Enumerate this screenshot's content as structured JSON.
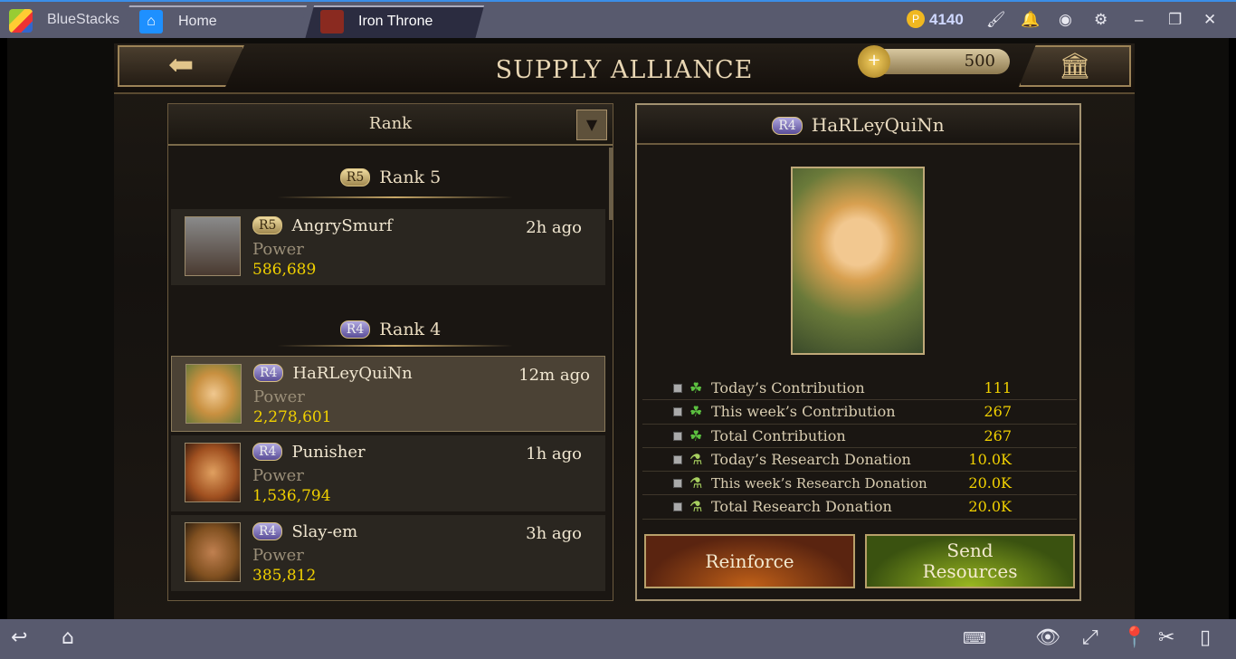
{
  "titlebar": {
    "app_name": "BlueStacks",
    "tabs": [
      {
        "label": "Home",
        "icon": "home-icon"
      },
      {
        "label": "Iron Throne",
        "icon": "game-icon"
      }
    ],
    "coins": "4140",
    "icons": [
      "brush-icon",
      "bell-icon",
      "account-icon",
      "gear-icon",
      "minimize-icon",
      "restore-icon",
      "close-icon"
    ]
  },
  "game": {
    "title": "SUPPLY ALLIANCE",
    "currency": "500",
    "sort": {
      "selected": "Rank"
    },
    "groups": [
      {
        "badge": "R5",
        "label": "Rank 5",
        "members": [
          {
            "badge": "R5",
            "name": "AngrySmurf",
            "time": "2h ago",
            "power_label": "Power",
            "power": "586,689"
          }
        ]
      },
      {
        "badge": "R4",
        "label": "Rank 4",
        "members": [
          {
            "badge": "R4",
            "name": "HaRLeyQuiNn",
            "time": "12m ago",
            "power_label": "Power",
            "power": "2,278,601",
            "selected": true
          },
          {
            "badge": "R4",
            "name": "Punisher",
            "time": "1h ago",
            "power_label": "Power",
            "power": "1,536,794"
          },
          {
            "badge": "R4",
            "name": "Slay-em",
            "time": "3h ago",
            "power_label": "Power",
            "power": "385,812"
          }
        ]
      }
    ],
    "detail": {
      "badge": "R4",
      "name": "HaRLeyQuiNn",
      "stats": [
        {
          "icon": "clover-icon",
          "label": "Today’s Contribution",
          "value": "111"
        },
        {
          "icon": "clover-icon",
          "label": "This week’s Contribution",
          "value": "267"
        },
        {
          "icon": "clover-icon",
          "label": "Total Contribution",
          "value": "267"
        },
        {
          "icon": "flask-icon",
          "label": "Today’s Research Donation",
          "value": "10.0K"
        },
        {
          "icon": "flask-icon",
          "label": "This week’s Research Donation",
          "value": "20.0K"
        },
        {
          "icon": "flask-icon",
          "label": "Total Research Donation",
          "value": "20.0K"
        }
      ],
      "reinforce_label": "Reinforce",
      "send_label": "Send Resources"
    }
  },
  "colors": {
    "accent_gold": "#f0d000",
    "titlebar": "#585a6e"
  }
}
